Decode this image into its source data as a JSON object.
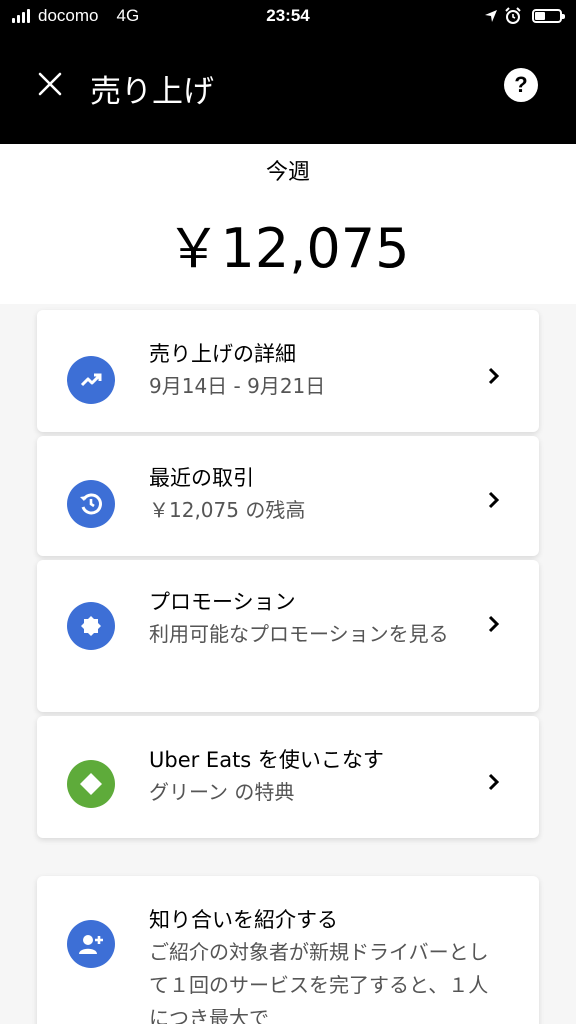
{
  "status": {
    "carrier": "docomo",
    "network": "4G",
    "time": "23:54"
  },
  "nav": {
    "title": "売り上げ",
    "help": "?"
  },
  "summary": {
    "period": "今週",
    "amount": "￥12,075"
  },
  "cards": [
    {
      "title": "売り上げの詳細",
      "subtitle": "9月14日 - 9月21日",
      "icon": "trend-up-icon",
      "color": "#3d6fd6"
    },
    {
      "title": "最近の取引",
      "subtitle": "￥12,075 の残高",
      "icon": "history-icon",
      "color": "#3d6fd6"
    },
    {
      "title": "プロモーション",
      "subtitle": "利用可能なプロモーションを見る",
      "icon": "badge-icon",
      "color": "#3d6fd6"
    },
    {
      "title": "Uber Eats を使いこなす",
      "subtitle": "グリーン の特典",
      "icon": "diamond-icon",
      "color": "#5eab3a"
    },
    {
      "title": "知り合いを紹介する",
      "subtitle": "ご紹介の対象者が新規ドライバーとして１回のサービスを完了すると、１人につき最大で",
      "icon": "add-person-icon",
      "color": "#3d6fd6"
    }
  ]
}
